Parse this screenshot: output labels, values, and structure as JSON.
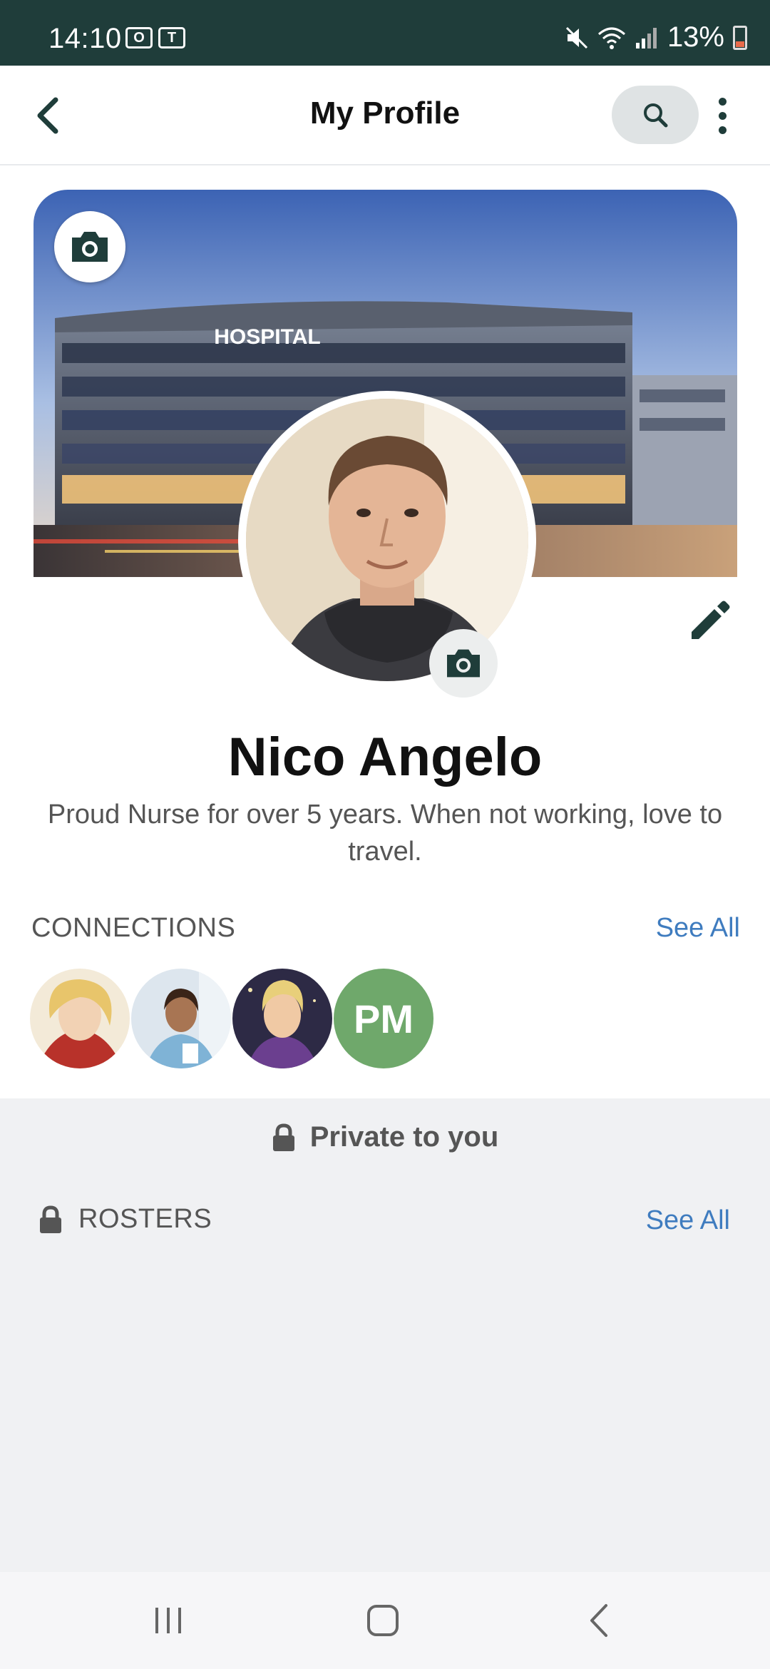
{
  "status_bar": {
    "time": "14:10",
    "app_icons": [
      "outlook-icon",
      "teams-icon"
    ],
    "battery_text": "13%",
    "icons": [
      "mute-icon",
      "wifi-icon",
      "signal-icon",
      "battery-icon"
    ]
  },
  "header": {
    "title": "My Profile"
  },
  "cover": {
    "building_sign": "HOSPITAL"
  },
  "profile": {
    "name": "Nico Angelo",
    "bio": "Proud Nurse for over 5 years. When not working, love to travel."
  },
  "connections": {
    "label": "CONNECTIONS",
    "see_all": "See All",
    "items": [
      {
        "type": "photo",
        "desc": "blonde-illustrated-avatar"
      },
      {
        "type": "photo",
        "desc": "nurse-photo-avatar"
      },
      {
        "type": "photo",
        "desc": "illustrated-man-avatar"
      },
      {
        "type": "initials",
        "initials": "PM",
        "color": "#6fa86b"
      }
    ]
  },
  "private": {
    "note": "Private to you",
    "rosters_label": "ROSTERS",
    "see_all": "See All"
  },
  "colors": {
    "accent": "#1f3d3a",
    "link": "#3f7cbf",
    "private_bg": "#f0f1f3"
  }
}
